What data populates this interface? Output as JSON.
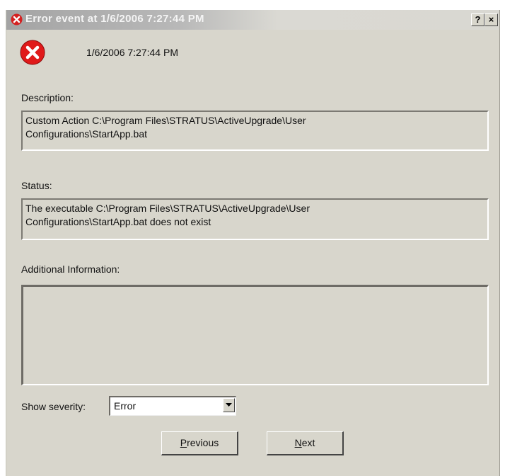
{
  "window": {
    "title": "Error event at 1/6/2006 7:27:44 PM",
    "help_button": "?",
    "close_button": "×"
  },
  "event": {
    "timestamp": "1/6/2006 7:27:44 PM",
    "icon": "error-icon"
  },
  "description": {
    "label": "Description:",
    "text": "Custom Action C:\\Program Files\\STRATUS\\ActiveUpgrade\\User\nConfigurations\\StartApp.bat"
  },
  "status": {
    "label": "Status:",
    "text": "The executable C:\\Program Files\\STRATUS\\ActiveUpgrade\\User\nConfigurations\\StartApp.bat does not exist"
  },
  "additional": {
    "label": "Additional Information:",
    "text": ""
  },
  "severity": {
    "label": "Show severity:",
    "value": "Error"
  },
  "buttons": {
    "previous_first": "P",
    "previous_rest": "revious",
    "next_first": "N",
    "next_rest": "ext"
  },
  "colors": {
    "error_red": "#e01a1a",
    "window_bg": "#d8d6cc"
  }
}
